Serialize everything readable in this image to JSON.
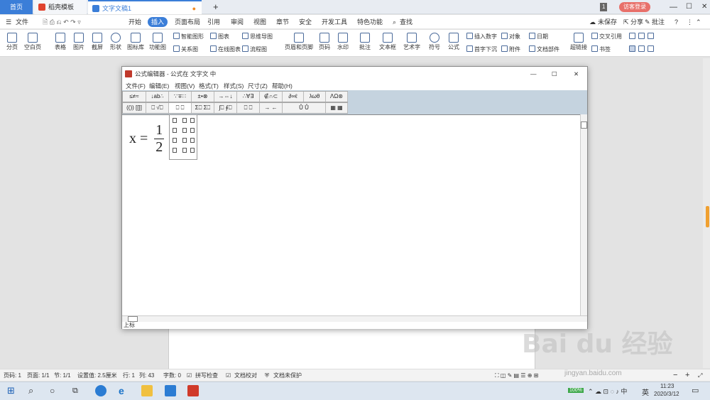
{
  "tabs": {
    "home": "首页",
    "template": "稻壳模板",
    "document": "文字文稿1",
    "new_tab": "+"
  },
  "titlebar_right": {
    "badge": "1",
    "login": "访客登录"
  },
  "menu": {
    "file": "文件",
    "items": [
      "开始",
      "插入",
      "页面布局",
      "引用",
      "审阅",
      "视图",
      "章节",
      "安全",
      "开发工具",
      "特色功能"
    ],
    "active": "插入",
    "search": "查找",
    "unsaved": "未保存",
    "share": "分享",
    "comment": "批注"
  },
  "toolbar": {
    "page_break": "分页",
    "blank_page": "空白页",
    "table": "表格",
    "picture": "图片",
    "screenshot": "截屏",
    "shape": "形状",
    "icon_lib": "图标库",
    "func_chart": "功能图",
    "smart_graphic": "智能图形",
    "chart": "图表",
    "mindmap": "思维导图",
    "relation": "关系图",
    "online_chart": "在线图表",
    "flowchart": "流程图",
    "header_footer": "页眉和页脚",
    "page_num": "页码",
    "watermark": "水印",
    "comment": "批注",
    "textbox": "文本框",
    "wordart": "艺术字",
    "symbol": "符号",
    "formula": "公式",
    "insert_number": "插入数字",
    "object": "对象",
    "date": "日期",
    "dropcap": "首字下沉",
    "attachment": "附件",
    "doc_parts": "文档部件",
    "hyperlink": "超链接",
    "crossref": "交叉引用",
    "bookmark": "书签"
  },
  "dialog": {
    "title": "公式编辑器 - 公式在 文字文 中",
    "menu": [
      "文件(F)",
      "编辑(E)",
      "视图(V)",
      "格式(T)",
      "样式(S)",
      "尺寸(Z)",
      "帮助(H)"
    ],
    "palette_row1": [
      "≤≠≈",
      "↓ab∴",
      "∵∓∷",
      "±•⊗",
      "→⇔↓",
      "∴∀∃",
      "∉∩⊂",
      "∂∞ℓ",
      "λωθ",
      "ΛΩ⊛"
    ],
    "palette_row2": [
      "(()) [[]]",
      "⎕ √⎕",
      "⎕ ⎕",
      "Σ⎕ Σ⎕",
      "∫⎕ ∮⎕",
      "⎕ ⎕",
      "→ ←",
      "Ů Ů",
      "▦ ▦"
    ],
    "formula": {
      "lhs": "x =",
      "numerator": "1",
      "denominator": "2"
    },
    "status": "上标",
    "controls": {
      "minimize": "—",
      "maximize": "☐",
      "close": "✕"
    }
  },
  "statusbar": {
    "page": "页码: 1",
    "pages": "页面: 1/1",
    "section": "节: 1/1",
    "setting": "设置值: 2.5厘米",
    "row": "行: 1",
    "col": "列: 43",
    "words": "字数: 0",
    "spell": "拼写检查",
    "proof": "文档校对",
    "protect": "文档未保护",
    "zoom_minus": "−",
    "zoom_plus": "+"
  },
  "taskbar": {
    "time": "11:23",
    "date": "2020/3/12",
    "lang": "英",
    "battery": "100%"
  },
  "watermark": {
    "text": "Bai du 经验",
    "url": "jingyan.baidu.com"
  }
}
